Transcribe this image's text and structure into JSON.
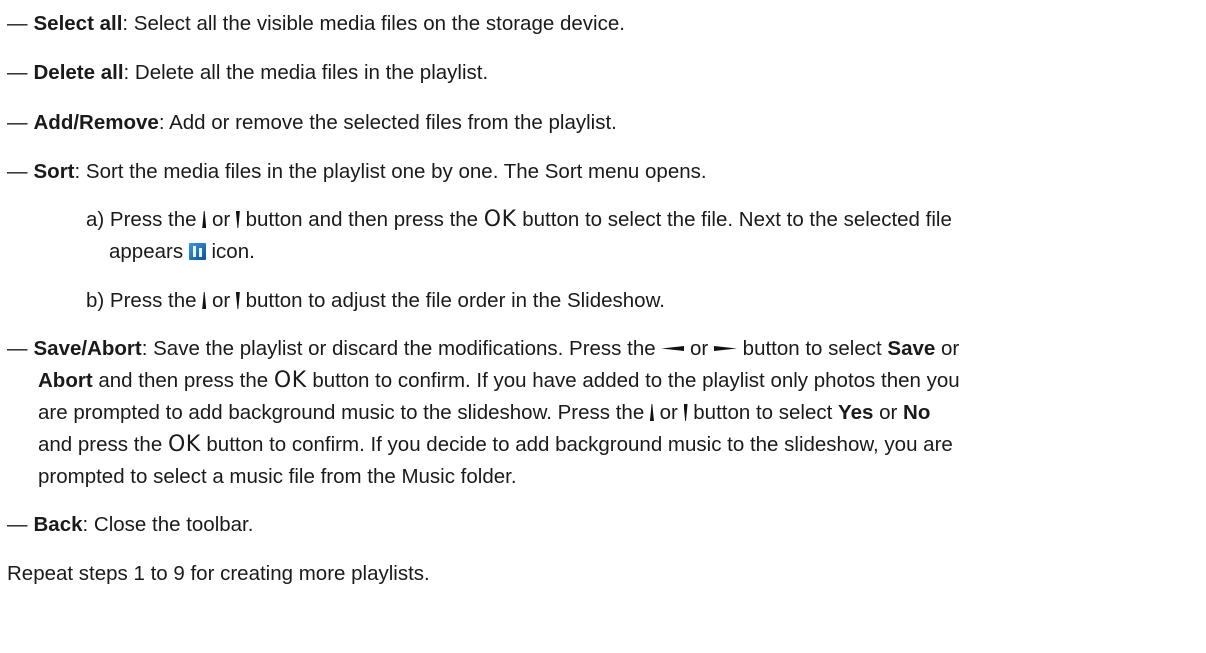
{
  "items": [
    {
      "dash": "—",
      "term": "Select all",
      "text": ": Select all the visible media files on the storage device."
    },
    {
      "dash": "—",
      "term": "Delete all",
      "text": ": Delete all the media files in the playlist."
    },
    {
      "dash": "—",
      "term": "Add/Remove",
      "text": ": Add or remove the selected files from the playlist."
    },
    {
      "dash": "—",
      "term": "Sort",
      "text": ": Sort the media files in the playlist one by one. The Sort menu opens."
    }
  ],
  "sort_steps": {
    "a_prefix": "a) Press the",
    "or": "or",
    "a_mid": "button and then press the",
    "ok": "OK",
    "a_rest": "button to select the file. Next to the selected file",
    "a_line2_pre": "appears",
    "a_line2_post": "icon.",
    "b_prefix": "b) Press the",
    "b_rest": "button to adjust the file order in the Slideshow."
  },
  "save_abort": {
    "dash": "—",
    "term": "Save/Abort",
    "l1_a": ": Save the playlist or discard the modifications. Press the",
    "or": "or",
    "l1_b": "button to select",
    "save": "Save",
    "l1_c": "or",
    "abort": "Abort",
    "l2_a": "and then press the",
    "ok": "OK",
    "l2_b": "button to confirm. If you have added to the playlist only photos then you",
    "l3_a": "are prompted to add background music to the slideshow. Press the",
    "l3_b": "button to select",
    "yes": "Yes",
    "no": "No",
    "l4_a": "and press the",
    "l4_b": "button to confirm. If you decide to add background music to the slideshow, you are",
    "l5": "prompted to select a music file from the Music folder."
  },
  "back": {
    "dash": "—",
    "term": "Back",
    "text": ": Close the toolbar."
  },
  "footer": "Repeat steps 1 to 9 for creating more playlists."
}
